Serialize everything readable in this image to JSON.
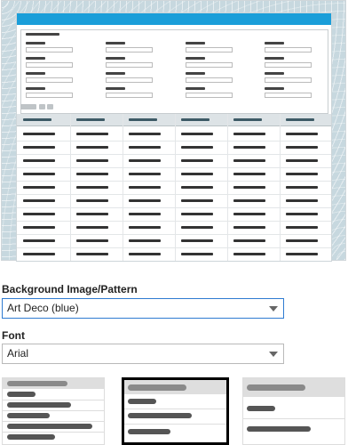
{
  "preview": {
    "theme_color": "#1a9ed9",
    "background_color": "#c7d8df"
  },
  "background_pattern": {
    "label": "Background Image/Pattern",
    "selected": "Art Deco (blue)",
    "icon": "chevron-down-icon"
  },
  "font": {
    "label": "Font",
    "selected": "Arial",
    "icon": "chevron-down-icon"
  },
  "table_styles": {
    "selected_index": 1,
    "selection_color": "#000000"
  }
}
